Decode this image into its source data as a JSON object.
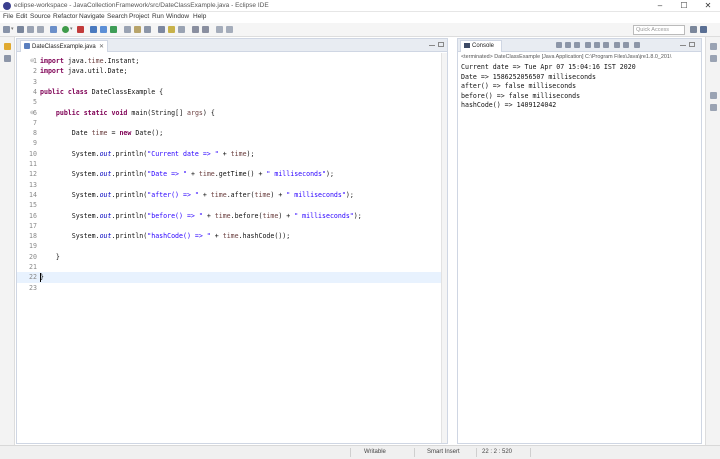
{
  "window": {
    "title": "eclipse-workspace - JavaCollectionFramework/src/DateClassExample.java - Eclipse IDE",
    "controls": [
      "–",
      "☐",
      "✕"
    ]
  },
  "menu": [
    "File",
    "Edit",
    "Source",
    "Refactor",
    "Navigate",
    "Search",
    "Project",
    "Run",
    "Window",
    "Help"
  ],
  "toolbar": {
    "quick_access_placeholder": "Quick Access"
  },
  "editor": {
    "tab_label": "DateClassExample.java",
    "tab_close": "✕",
    "lines": [
      {
        "n": "1",
        "code": "import java.time.Instant;"
      },
      {
        "n": "2",
        "code": "import java.util.Date;"
      },
      {
        "n": "3",
        "code": ""
      },
      {
        "n": "4",
        "code": "public class DateClassExample {"
      },
      {
        "n": "5",
        "code": ""
      },
      {
        "n": "6",
        "code": "    public static void main(String[] args) {"
      },
      {
        "n": "7",
        "code": ""
      },
      {
        "n": "8",
        "code": "        Date time = new Date();"
      },
      {
        "n": "9",
        "code": ""
      },
      {
        "n": "10",
        "code": "        System.out.println(\"Current date => \" + time);"
      },
      {
        "n": "11",
        "code": ""
      },
      {
        "n": "12",
        "code": "        System.out.println(\"Date => \" + time.getTime() + \" milliseconds\");"
      },
      {
        "n": "13",
        "code": ""
      },
      {
        "n": "14",
        "code": "        System.out.println(\"after() => \" + time.after(time) + \" milliseconds\");"
      },
      {
        "n": "15",
        "code": ""
      },
      {
        "n": "16",
        "code": "        System.out.println(\"before() => \" + time.before(time) + \" milliseconds\");"
      },
      {
        "n": "17",
        "code": ""
      },
      {
        "n": "18",
        "code": "        System.out.println(\"hashCode() => \" + time.hashCode());"
      },
      {
        "n": "19",
        "code": ""
      },
      {
        "n": "20",
        "code": "    }"
      },
      {
        "n": "21",
        "code": ""
      },
      {
        "n": "22",
        "code": "}"
      },
      {
        "n": "23",
        "code": ""
      }
    ],
    "current_line": "22"
  },
  "console": {
    "tab_label": "Console",
    "status": "<terminated> DateClassExample [Java Application] C:\\Program Files\\Java\\jre1.8.0_201\\",
    "output": [
      "Current date => Tue Apr 07 15:04:16 IST 2020",
      "Date => 1586252056507 milliseconds",
      "after() => false milliseconds",
      "before() => false milliseconds",
      "hashCode() => 1409124042"
    ]
  },
  "statusbar": {
    "writable": "Writable",
    "insert_mode": "Smart Insert",
    "position": "22 : 2 : 520"
  },
  "colors": {
    "keyword": "#7f0055",
    "string": "#2a00ff",
    "field": "#0000c0",
    "current_line": "#e8f2fe"
  }
}
